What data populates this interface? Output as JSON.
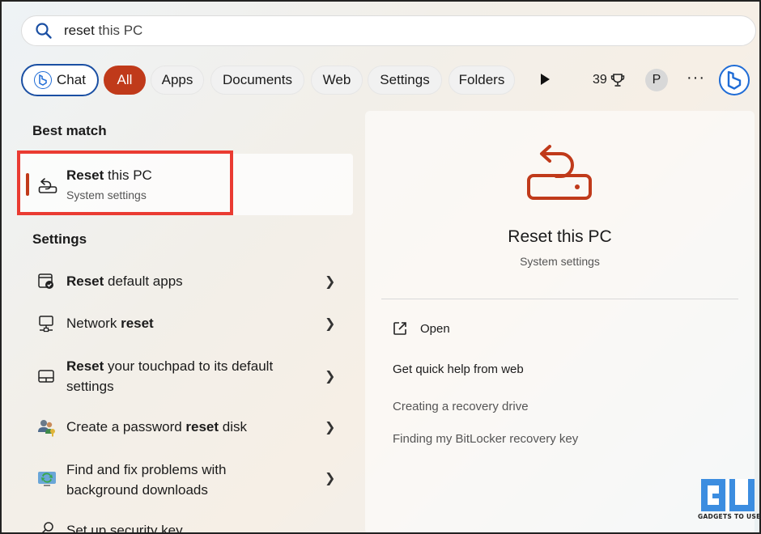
{
  "search": {
    "query_bold": "reset",
    "query_rest": " this PC"
  },
  "filters": {
    "chat": "Chat",
    "all": "All",
    "apps": "Apps",
    "documents": "Documents",
    "web": "Web",
    "settings": "Settings",
    "folders": "Folders",
    "points": "39",
    "avatar_initial": "P",
    "more": "···"
  },
  "best_match": {
    "heading": "Best match",
    "title_bold": "Reset",
    "title_rest": " this PC",
    "subtitle": "System settings"
  },
  "settings_section": {
    "heading": "Settings",
    "items": [
      {
        "pre": "",
        "bold": "Reset",
        "post": " default apps",
        "line2": "",
        "icon": "default-apps-icon"
      },
      {
        "pre": "Network ",
        "bold": "reset",
        "post": "",
        "line2": "",
        "icon": "network-icon"
      },
      {
        "pre": "",
        "bold": "Reset",
        "post": " your touchpad to its default",
        "line2": "settings",
        "icon": "touchpad-icon"
      },
      {
        "pre": "Create a password ",
        "bold": "reset",
        "post": " disk",
        "line2": "",
        "icon": "users-key-icon"
      },
      {
        "pre": "Find and fix problems with",
        "bold": "",
        "post": "",
        "line2": "background downloads",
        "icon": "troubleshoot-icon"
      },
      {
        "pre": "Set up security key",
        "bold": "",
        "post": "",
        "line2": "",
        "icon": "security-key-icon"
      }
    ]
  },
  "preview": {
    "title": "Reset this PC",
    "subtitle": "System settings",
    "open": "Open",
    "quick_help": "Get quick help from web",
    "links": [
      "Creating a recovery drive",
      "Finding my BitLocker recovery key"
    ]
  },
  "watermark": {
    "text": "GADGETS TO USE"
  },
  "colors": {
    "accent": "#c03a1a",
    "highlight": "#ea3b32",
    "bing": "#1f6cd6"
  }
}
